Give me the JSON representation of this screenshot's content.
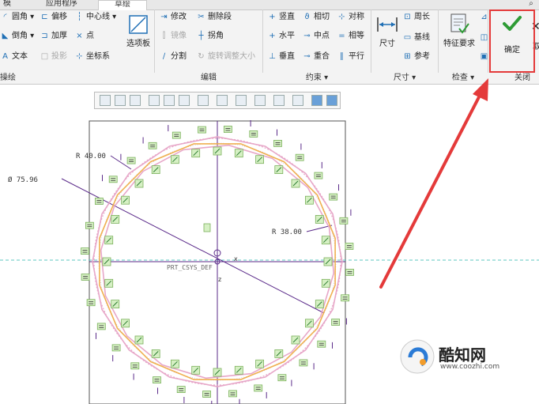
{
  "tabs": [
    "模",
    "应用程序",
    "草绘"
  ],
  "groups": {
    "edge_label": "操绘",
    "edit_label": "编辑",
    "constraint_label": "约束 ▾",
    "dimension_label": "尺寸 ▾",
    "inspect_label": "检查 ▾",
    "close_label": "关闭"
  },
  "sketch_col1": [
    "圆角",
    "倒角",
    "文本"
  ],
  "sketch_col2": [
    "偏移",
    "加厚",
    "投影"
  ],
  "sketch_col3": [
    "中心线",
    "点",
    "坐标系"
  ],
  "palette_label": "选项板",
  "edit_items": [
    "修改",
    "删除段",
    "镜像",
    "拐角",
    "分割",
    "旋转调整大小"
  ],
  "constraint_items": [
    "竖直",
    "相切",
    "对称",
    "水平",
    "中点",
    "相等",
    "垂直",
    "重合",
    "平行"
  ],
  "dimension": {
    "big": "尺寸",
    "items": [
      "周长",
      "基线",
      "参考"
    ]
  },
  "inspect": {
    "big": "特征要求"
  },
  "confirm_label": "确定",
  "cancel_label": "取",
  "sketch": {
    "dim_r40": "R 40.00",
    "dim_dia": "Ø 75.96",
    "dim_r38": "R 38.00",
    "csys": "PRT_CSYS_DEF",
    "axis_x": "x",
    "axis_z": "z"
  },
  "watermark": {
    "brand": "酷知网",
    "url": "www.coozhi.com"
  },
  "colors": {
    "arrow": "#e43a3a",
    "constraint_box": "#d6f0c4",
    "confirm_check": "#2e9b35",
    "sketch_pink": "#e7a7c8",
    "sketch_orange": "#f0b050",
    "axis_purple": "#5b2b8a",
    "ref_line": "#5ec7c0"
  }
}
